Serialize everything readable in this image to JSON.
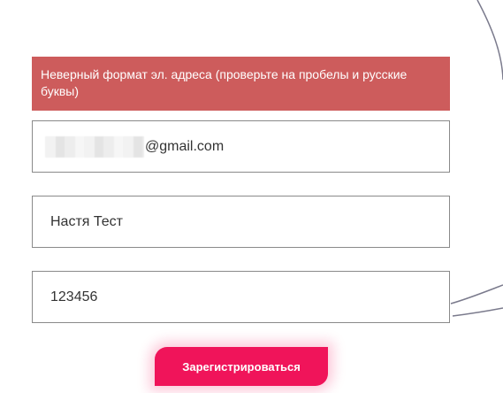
{
  "error": {
    "message": "Неверный формат эл. адреса (проверьте на пробелы и русские буквы)"
  },
  "form": {
    "email_visible_suffix": "@gmail.com",
    "name_value": "Настя Тест",
    "password_value": "123456",
    "submit_label": "Зарегистрироваться"
  },
  "colors": {
    "error_background": "#cd5c5c",
    "accent": "#f0145a",
    "decor_line": "#7a7a8c"
  }
}
